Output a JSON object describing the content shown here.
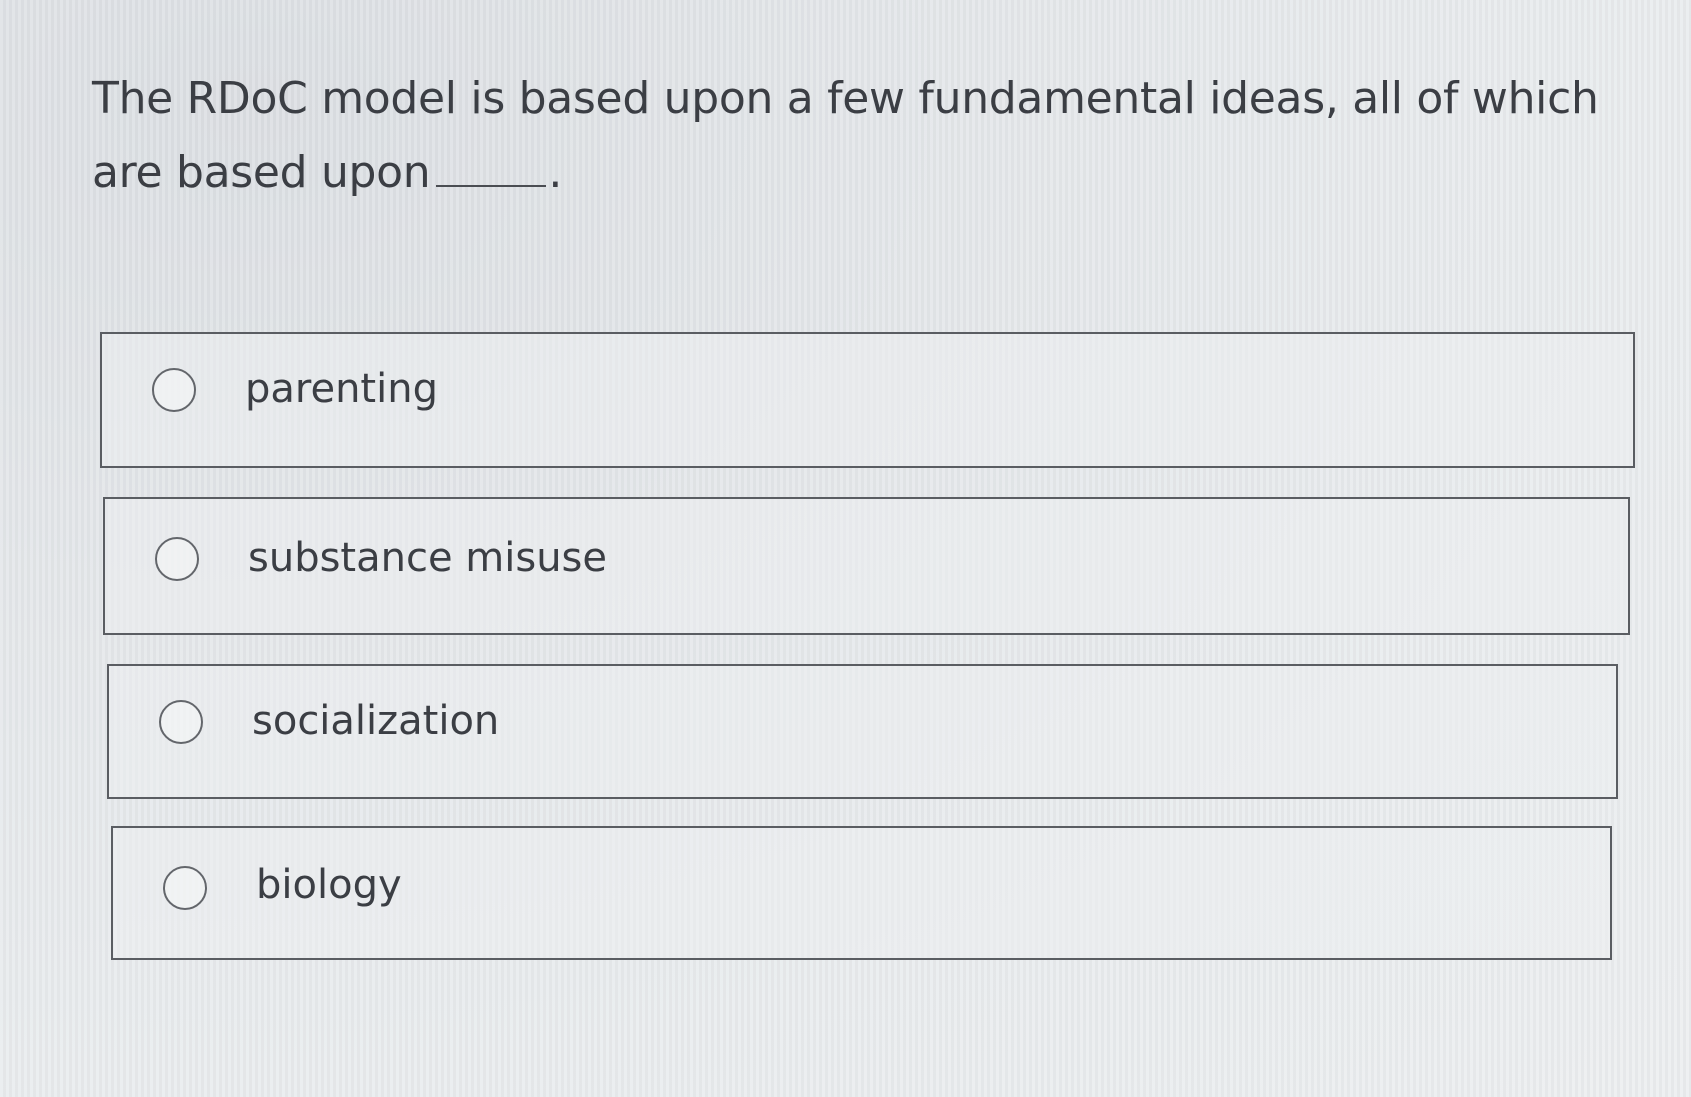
{
  "question": {
    "text": "The RDoC model is based upon a few fundamental ideas, all of which are based upon",
    "period": "."
  },
  "options": [
    {
      "label": "parenting"
    },
    {
      "label": "substance misuse"
    },
    {
      "label": "socialization"
    },
    {
      "label": "biology"
    }
  ]
}
